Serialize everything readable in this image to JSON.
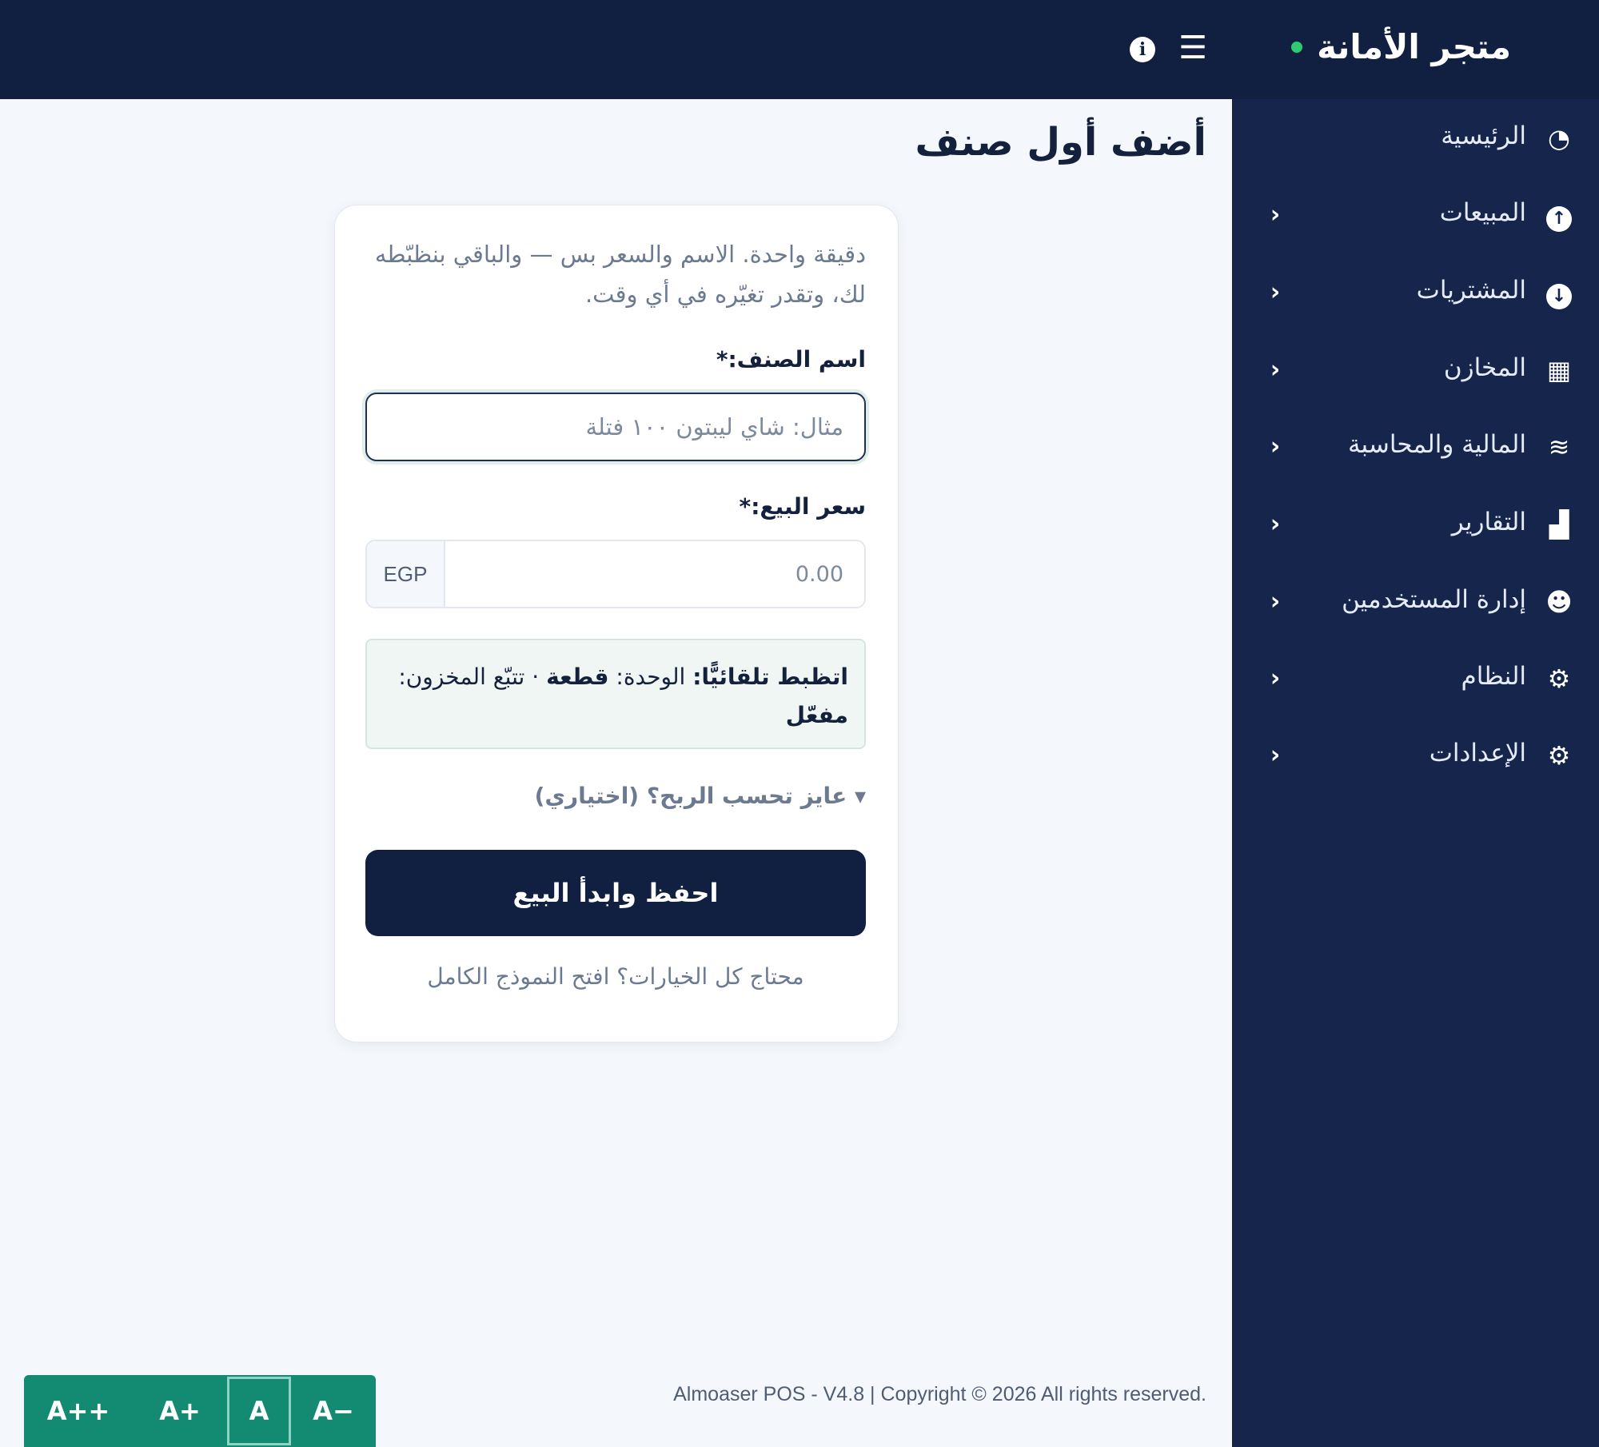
{
  "header": {
    "brand": "متجر الأمانة",
    "menu_icon": "☰",
    "info_icon": "i"
  },
  "sidebar": {
    "items": [
      {
        "label": "الرئيسية",
        "icon": "dashboard-icon",
        "glyph": "◔",
        "has_chevron": false
      },
      {
        "label": "المبيعات",
        "icon": "arrow-up-circle-icon",
        "glyph": "↑",
        "has_chevron": true
      },
      {
        "label": "المشتريات",
        "icon": "arrow-down-circle-icon",
        "glyph": "↓",
        "has_chevron": true
      },
      {
        "label": "المخازن",
        "icon": "warehouse-icon",
        "glyph": "▦",
        "has_chevron": true
      },
      {
        "label": "المالية والمحاسبة",
        "icon": "coins-icon",
        "glyph": "≋",
        "has_chevron": true
      },
      {
        "label": "التقارير",
        "icon": "bar-chart-icon",
        "glyph": "▟",
        "has_chevron": true
      },
      {
        "label": "إدارة المستخدمين",
        "icon": "users-icon",
        "glyph": "☻",
        "has_chevron": true
      },
      {
        "label": "النظام",
        "icon": "gears-icon",
        "glyph": "⚙",
        "has_chevron": true
      },
      {
        "label": "الإعدادات",
        "icon": "gear-icon",
        "glyph": "⚙",
        "has_chevron": true
      }
    ],
    "chevron": "‹"
  },
  "main": {
    "title": "أضف أول صنف"
  },
  "form": {
    "intro": "دقيقة واحدة. الاسم والسعر بس — والباقي بنظبّطه لك، وتقدر تغيّره في أي وقت.",
    "name_label": "اسم الصنف:*",
    "name_placeholder": "مثال: شاي ليبتون ١٠٠ فتلة",
    "price_label": "سعر البيع:*",
    "price_placeholder": "0.00",
    "currency": "EGP",
    "auto_title": "اتظبط تلقائيًّا:",
    "auto_unit_label": "الوحدة:",
    "auto_unit_value": "قطعة",
    "auto_separator": "·",
    "auto_track_label": "تتبّع المخزون:",
    "auto_track_value": "مفعّل",
    "profit_toggle": "▾ عايز تحسب الربح؟ (اختياري)",
    "save_button": "احفظ وابدأ البيع",
    "full_form_link": "محتاج كل الخيارات؟ افتح النموذج الكامل"
  },
  "footer": {
    "copyright": "Almoaser POS - V4.8 | Copyright © 2026 All rights reserved."
  },
  "font_controls": {
    "decrease_more": "A−",
    "reset": "A",
    "increase": "A+",
    "increase_more": "A++"
  }
}
